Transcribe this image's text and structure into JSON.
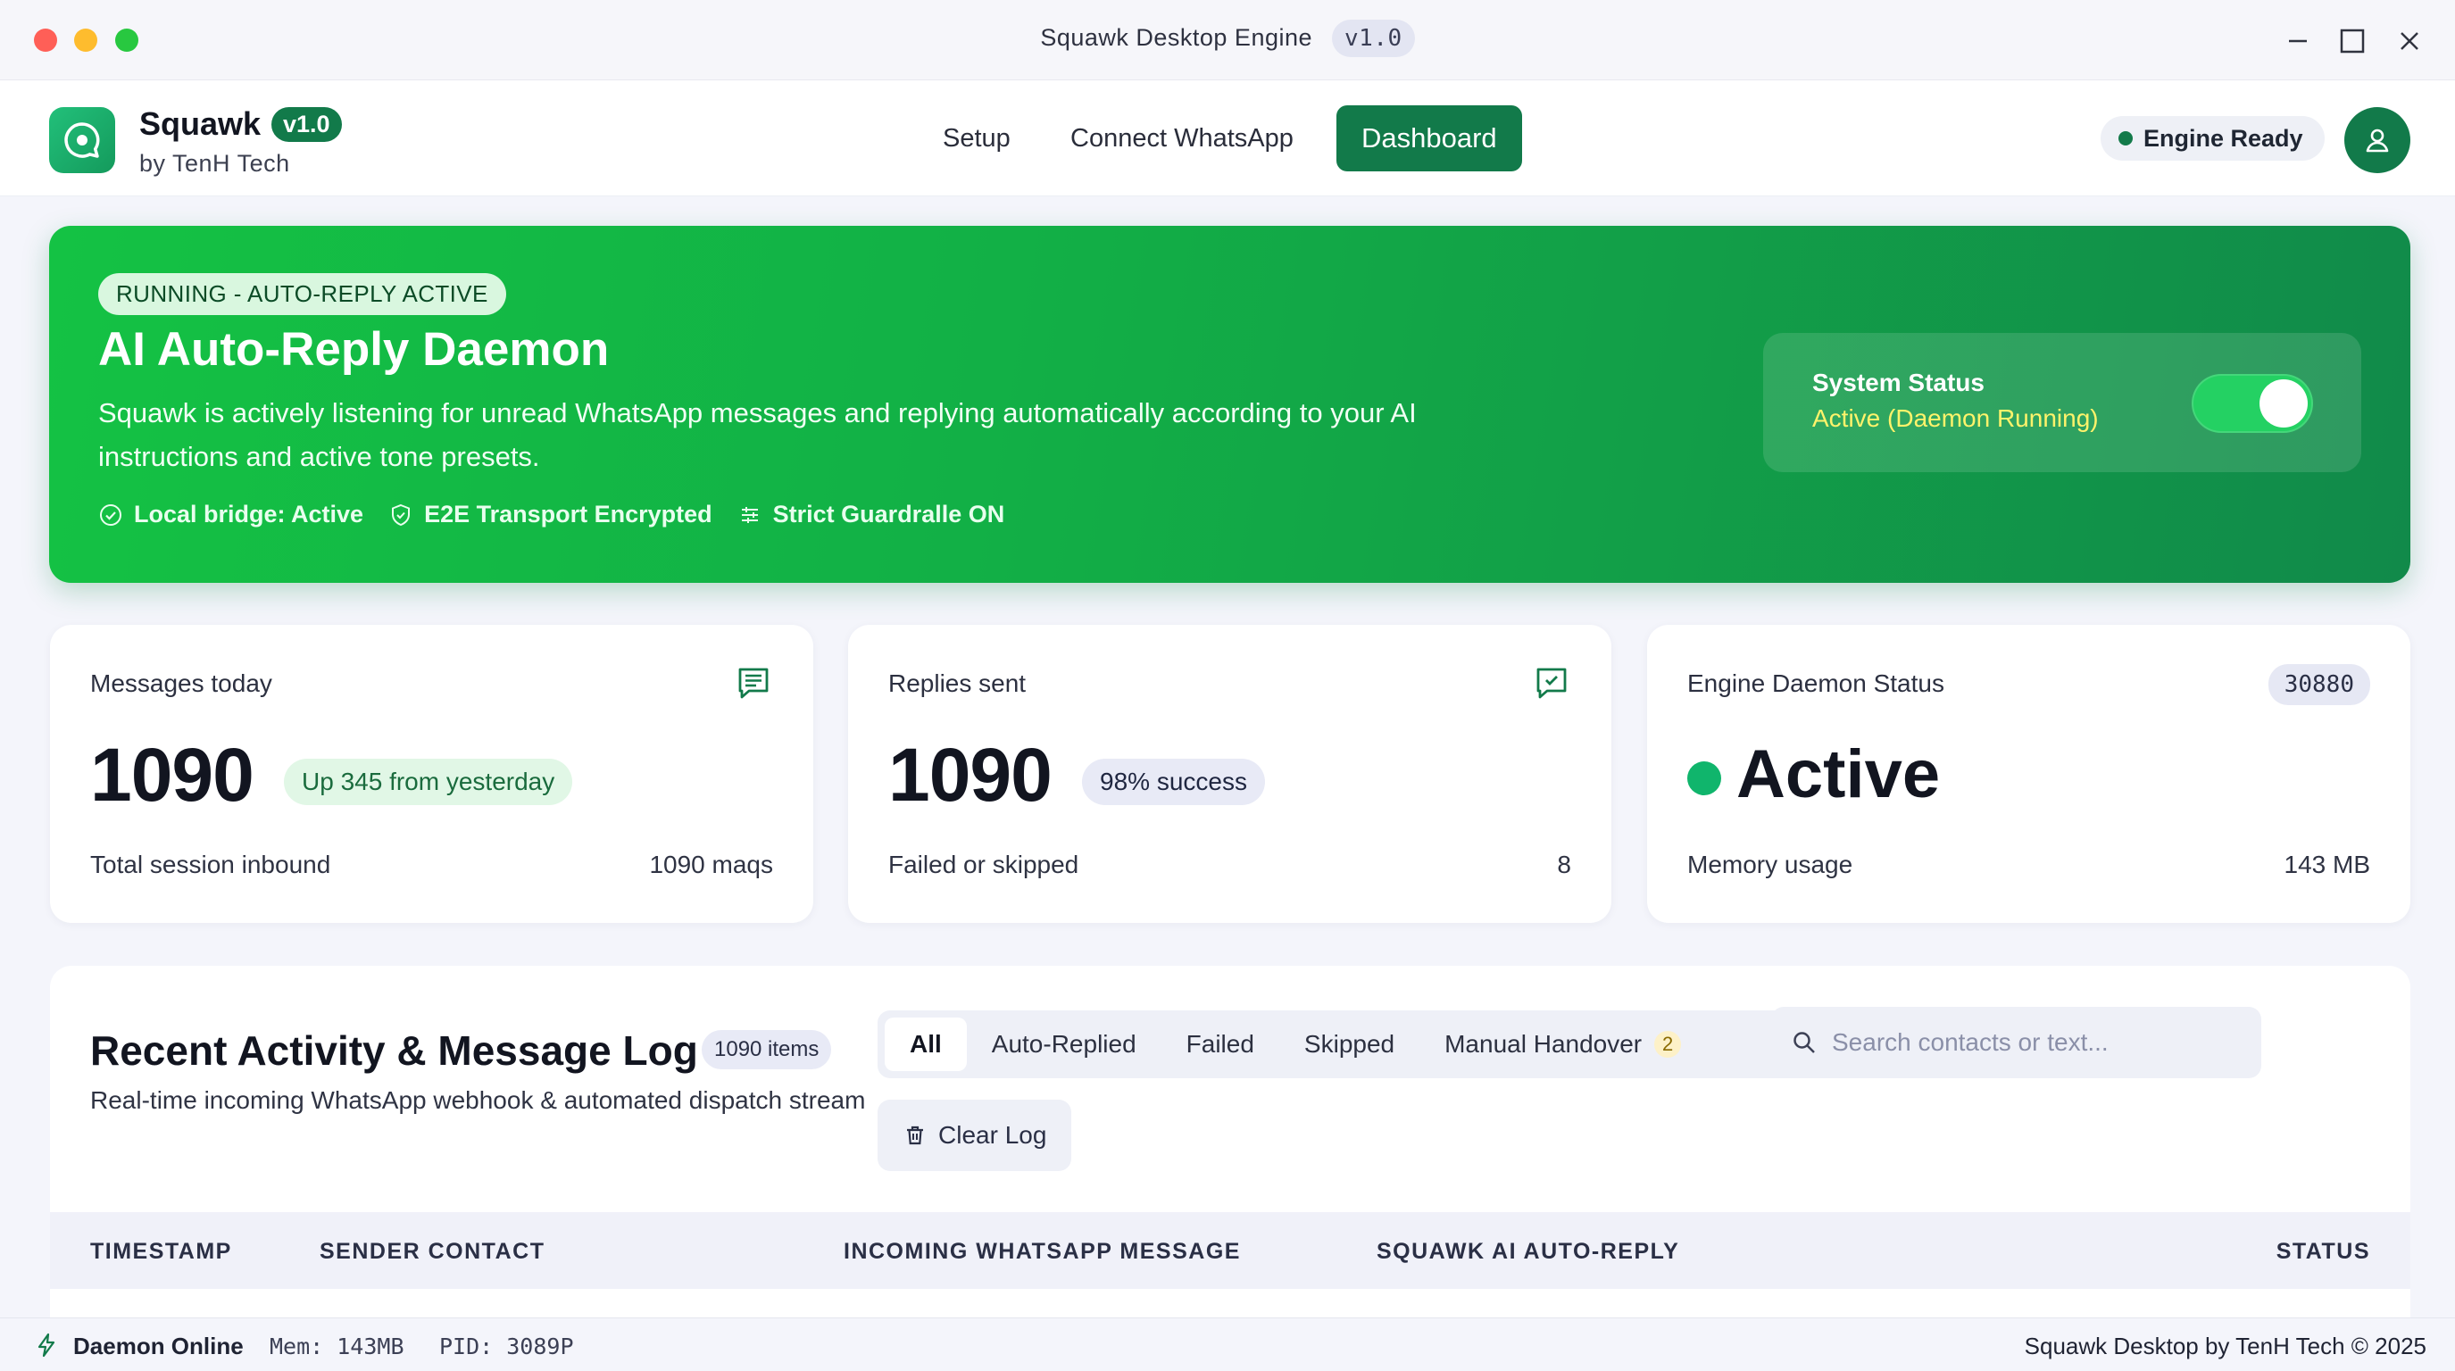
{
  "window": {
    "title": "Squawk Desktop Engine",
    "version": "v1.0"
  },
  "brand": {
    "name": "Squawk",
    "badge": "v1.0",
    "subtitle": "by TenH Tech"
  },
  "nav": {
    "items": [
      {
        "label": "Setup",
        "active": false
      },
      {
        "label": "Connect WhatsApp",
        "active": false
      },
      {
        "label": "Dashboard",
        "active": true
      }
    ]
  },
  "header": {
    "engine_status": "Engine Ready"
  },
  "hero": {
    "pill": "RUNNING - AUTO-REPLY ACTIVE",
    "title": "AI Auto-Reply Daemon",
    "description": "Squawk is actively listening for unread WhatsApp messages and replying automatically according to your AI instructions and active tone presets.",
    "tags": [
      {
        "label": "Local bridge: Active",
        "icon": "check-circle-icon"
      },
      {
        "label": "E2E Transport Encrypted",
        "icon": "shield-icon"
      },
      {
        "label": "Strict Guardralle ON",
        "icon": "sliders-icon"
      }
    ],
    "system_status": {
      "label": "System Status",
      "value": "Active (Daemon Running)",
      "enabled": true
    }
  },
  "stats": {
    "messages": {
      "label": "Messages today",
      "value": "1090",
      "chip": "Up 345 from yesterday",
      "foot_label": "Total session inbound",
      "foot_value": "1090 maqs"
    },
    "replies": {
      "label": "Replies sent",
      "value": "1090",
      "chip": "98% success",
      "foot_label": "Failed or skipped",
      "foot_value": "8"
    },
    "engine": {
      "label": "Engine Daemon Status",
      "badge": "30880",
      "value": "Active",
      "foot_label": "Memory usage",
      "foot_value": "143 MB"
    }
  },
  "activity": {
    "title": "Recent Activity & Message Log",
    "count": "1090 items",
    "subtitle": "Real-time incoming WhatsApp webhook & automated dispatch stream",
    "filters": [
      {
        "label": "All",
        "active": true
      },
      {
        "label": "Auto-Replied",
        "active": false
      },
      {
        "label": "Failed",
        "active": false
      },
      {
        "label": "Skipped",
        "active": false
      },
      {
        "label": "Manual Handover",
        "active": false,
        "count": "2"
      }
    ],
    "search_placeholder": "Search contacts or text...",
    "clear_label": "Clear Log",
    "columns": [
      "TIMESTAMP",
      "SENDER CONTACT",
      "INCOMING WHATSAPP MESSAGE",
      "SQUAWK AI AUTO-REPLY",
      "STATUS"
    ]
  },
  "footer": {
    "status": "Daemon Online",
    "mem": "Mem: 143MB",
    "pid": "PID: 3089P",
    "copyright": "Squawk Desktop by TenH Tech © 2025"
  },
  "colors": {
    "brand": "#127a4a",
    "hero_start": "#14c244",
    "hero_end": "#118a4a",
    "status_value": "#fff36b"
  }
}
